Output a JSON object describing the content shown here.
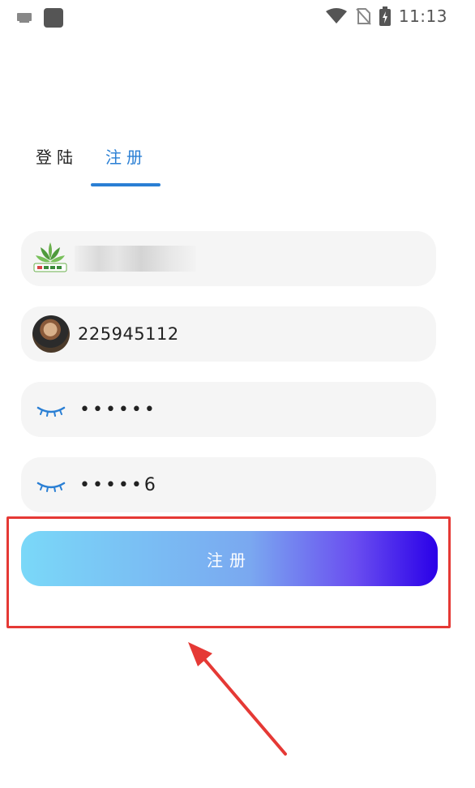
{
  "status_bar": {
    "time": "11:13",
    "icons": [
      "message-icon",
      "app-square-icon",
      "wifi-icon",
      "no-sim-icon",
      "battery-icon"
    ]
  },
  "tabs": {
    "login": "登陆",
    "register": "注册",
    "active": "register"
  },
  "fields": {
    "account_icon": "logo-icon",
    "qq_number": "225945112",
    "password_mask": "••••••",
    "confirm_password_mask": "•••••6"
  },
  "submit": {
    "label": "注册"
  },
  "colors": {
    "accent": "#2a7fd4",
    "highlight": "#e53935",
    "gradient_start": "#7ad8f8",
    "gradient_end": "#2a00e8"
  }
}
